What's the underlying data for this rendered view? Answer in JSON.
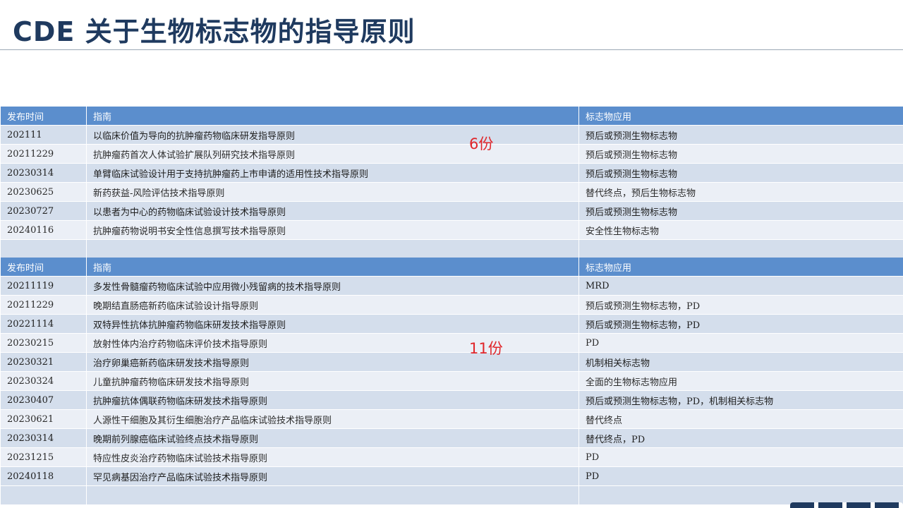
{
  "title": "CDE 关于生物标志物的指导原则",
  "notes": {
    "top_count": "6份",
    "bottom_count": "11份"
  },
  "headers": [
    "发布时间",
    "指南",
    "标志物应用"
  ],
  "table1": [
    {
      "date": "202111",
      "guide": "以临床价值为导向的抗肿瘤药物临床研发指导原则",
      "app": "预后或预测生物标志物"
    },
    {
      "date": "20211229",
      "guide": "抗肿瘤药首次人体试验扩展队列研究技术指导原则",
      "app": "预后或预测生物标志物"
    },
    {
      "date": "20230314",
      "guide": "单臂临床试验设计用于支持抗肿瘤药上市申请的适用性技术指导原则",
      "app": "预后或预测生物标志物"
    },
    {
      "date": "20230625",
      "guide": "新药获益-风险评估技术指导原则",
      "app": "替代终点，预后生物标志物"
    },
    {
      "date": "20230727",
      "guide": "以患者为中心的药物临床试验设计技术指导原则",
      "app": "预后或预测生物标志物"
    },
    {
      "date": "20240116",
      "guide": "抗肿瘤药物说明书安全性信息撰写技术指导原则",
      "app": "安全性生物标志物"
    }
  ],
  "table2": [
    {
      "date": "20211119",
      "guide": "多发性骨髓瘤药物临床试验中应用微小残留病的技术指导原则",
      "app": "MRD"
    },
    {
      "date": "20211229",
      "guide": "晚期结直肠癌新药临床试验设计指导原则",
      "app": "预后或预测生物标志物，PD"
    },
    {
      "date": "20221114",
      "guide": "双特异性抗体抗肿瘤药物临床研发技术指导原则",
      "app": "预后或预测生物标志物，PD"
    },
    {
      "date": "20230215",
      "guide": "放射性体内治疗药物临床评价技术指导原则",
      "app": "PD"
    },
    {
      "date": "20230321",
      "guide": "治疗卵巢癌新药临床研发技术指导原则",
      "app": "机制相关标志物"
    },
    {
      "date": "20230324",
      "guide": "儿童抗肿瘤药物临床研发技术指导原则",
      "app": "全面的生物标志物应用"
    },
    {
      "date": "20230407",
      "guide": "抗肿瘤抗体偶联药物临床研发技术指导原则",
      "app": "预后或预测生物标志物，PD，机制相关标志物"
    },
    {
      "date": "20230621",
      "guide": "人源性干细胞及其衍生细胞治疗产品临床试验技术指导原则",
      "app": "替代终点"
    },
    {
      "date": "20230314",
      "guide": "晚期前列腺癌临床试验终点技术指导原则",
      "app": "替代终点，PD"
    },
    {
      "date": "20231215",
      "guide": "特应性皮炎治疗药物临床试验技术指导原则",
      "app": "PD"
    },
    {
      "date": "20240118",
      "guide": "罕见病基因治疗产品临床试验技术指导原则",
      "app": "PD"
    }
  ]
}
